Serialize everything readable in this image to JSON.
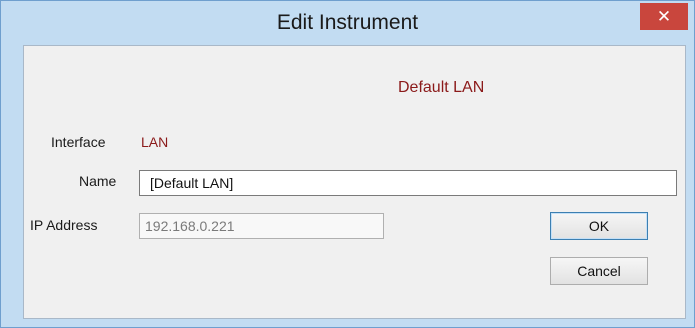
{
  "window": {
    "title": "Edit Instrument",
    "close_glyph": "✕",
    "close_icon": "close-icon"
  },
  "form": {
    "device_heading": "Default LAN",
    "interface_label": "Interface",
    "interface_value": "LAN",
    "name_label": "Name",
    "name_value": "[Default LAN]",
    "ip_label": "IP Address",
    "ip_value": "192.168.0.221"
  },
  "buttons": {
    "ok_label": "OK",
    "cancel_label": "Cancel"
  },
  "colors": {
    "accent_text": "#8b1a1a",
    "frame": "#c2dcf2",
    "close_button": "#c9463d"
  }
}
